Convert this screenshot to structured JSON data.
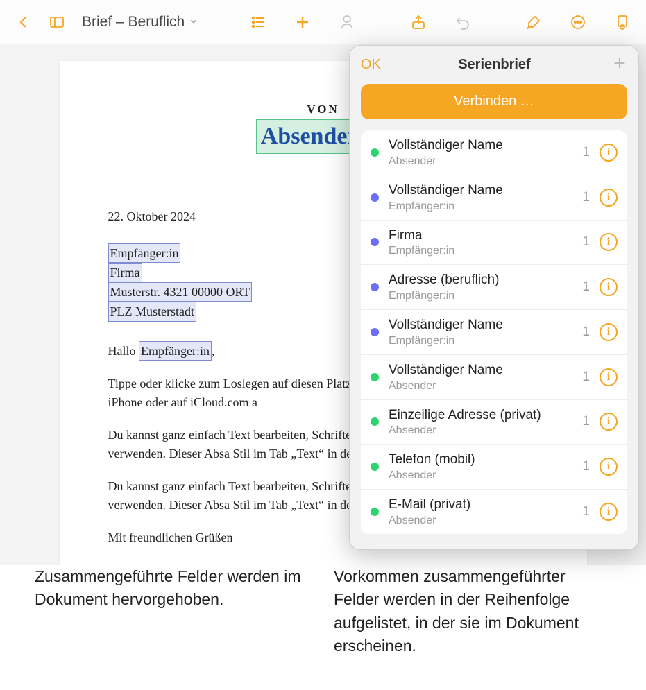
{
  "toolbar": {
    "doc_title": "Brief – Beruflich"
  },
  "document": {
    "von_label": "VON",
    "sender_field": "Absender:in",
    "date": "22. Oktober 2024",
    "recipient_name": "Empfänger:in",
    "recipient_company": "Firma",
    "recipient_addr1": "Musterstr. 4321 00000 ORT",
    "recipient_addr2": "PLZ Musterstadt",
    "greeting_pre": "Hallo ",
    "greeting_field": "Empfänger:in",
    "greeting_post": ",",
    "para1": "Tippe oder klicke zum Loslegen auf diesen Platzhalter ment auf dem Mac, iPad, iPhone oder auf iCloud.com a",
    "para2": "Du kannst ganz einfach Text bearbeiten, Schriften änd konsistentes Dokumentlayout verwenden. Dieser Absa Stil im Tab „Text“ in den Formatoptionen ändern.",
    "para3": "Du kannst ganz einfach Text bearbeiten, Schriften änd konsistentes Dokumentlayout verwenden. Dieser Absa Stil im Tab „Text“ in den Formatoptionen ändern.",
    "closing": "Mit freundlichen Grüßen"
  },
  "panel": {
    "ok": "OK",
    "title": "Serienbrief",
    "connect": "Verbinden …",
    "fields": [
      {
        "color": "green",
        "name": "Vollständiger Name",
        "sub": "Absender",
        "count": "1"
      },
      {
        "color": "blue",
        "name": "Vollständiger Name",
        "sub": "Empfänger:in",
        "count": "1"
      },
      {
        "color": "blue",
        "name": "Firma",
        "sub": "Empfänger:in",
        "count": "1"
      },
      {
        "color": "blue",
        "name": "Adresse (beruflich)",
        "sub": "Empfänger:in",
        "count": "1"
      },
      {
        "color": "blue",
        "name": "Vollständiger Name",
        "sub": "Empfänger:in",
        "count": "1"
      },
      {
        "color": "green",
        "name": "Vollständiger Name",
        "sub": "Absender",
        "count": "1"
      },
      {
        "color": "green",
        "name": "Einzeilige Adresse (privat)",
        "sub": "Absender",
        "count": "1"
      },
      {
        "color": "green",
        "name": "Telefon (mobil)",
        "sub": "Absender",
        "count": "1"
      },
      {
        "color": "green",
        "name": "E-Mail (privat)",
        "sub": "Absender",
        "count": "1"
      }
    ]
  },
  "callouts": {
    "left": "Zusammengeführte Felder werden im Dokument hervorgehoben.",
    "right": "Vorkommen zusammengeführter Felder werden in der Reihenfolge aufgelistet, in der sie im Dokument erscheinen."
  }
}
